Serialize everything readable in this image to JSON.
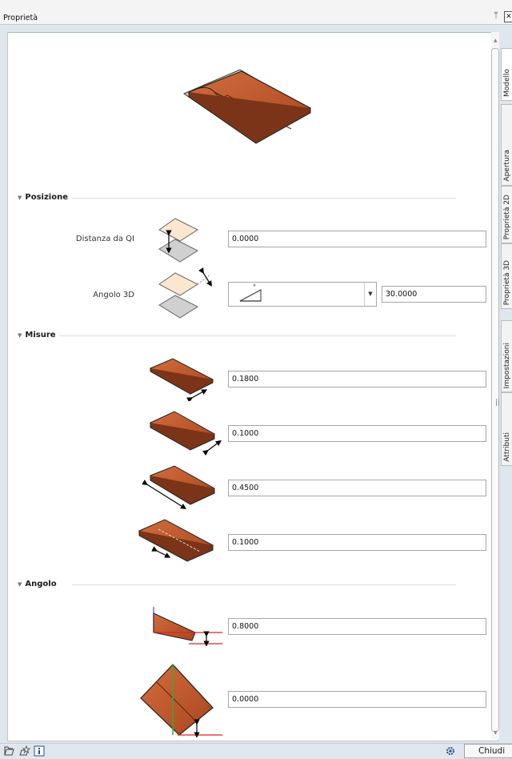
{
  "window": {
    "title": "Proprietà",
    "pin_glyph": "ᛘ",
    "close_glyph": "✕"
  },
  "side_tabs": [
    "Modello",
    "Apertura",
    "Proprietà 2D",
    "Proprietà 3D",
    "Impostazioni",
    "Attributi"
  ],
  "sections": {
    "posizione": "Posizione",
    "misure": "Misure",
    "angolo": "Angolo"
  },
  "posizione": {
    "distanza_label": "Distanza da QI",
    "distanza_value": "0.0000",
    "angolo_label": "Angolo 3D",
    "angolo_value": "30.0000",
    "angolo_unit_symbol": "°"
  },
  "misure": {
    "values": [
      "0.1800",
      "0.1000",
      "0.4500",
      "0.1000"
    ]
  },
  "angolo": {
    "values": [
      "0.8000",
      "0.0000"
    ]
  },
  "footer": {
    "close_label": "Chiudi",
    "icons": [
      "open-favorite-icon",
      "save-favorite-icon",
      "info-icon",
      "settings-icon"
    ]
  },
  "colors": {
    "tile": "#c0582a",
    "tile_dark": "#8a3716",
    "accent_line": "#9cc5a0",
    "dimension_red": "#e02020"
  }
}
